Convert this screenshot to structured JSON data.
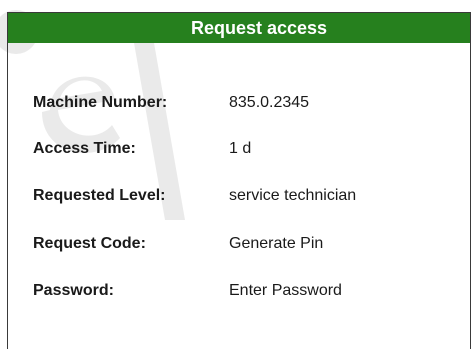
{
  "dialog": {
    "title": "Request access",
    "header_color": "#26801e"
  },
  "fields": [
    {
      "label": "Machine Number:",
      "value": "835.0.2345"
    },
    {
      "label": "Access Time:",
      "value": "1 d"
    },
    {
      "label": "Requested Level:",
      "value": "service technician"
    },
    {
      "label": "Request Code:",
      "value": "Generate Pin"
    },
    {
      "label": "Password:",
      "value": "Enter Password"
    }
  ]
}
